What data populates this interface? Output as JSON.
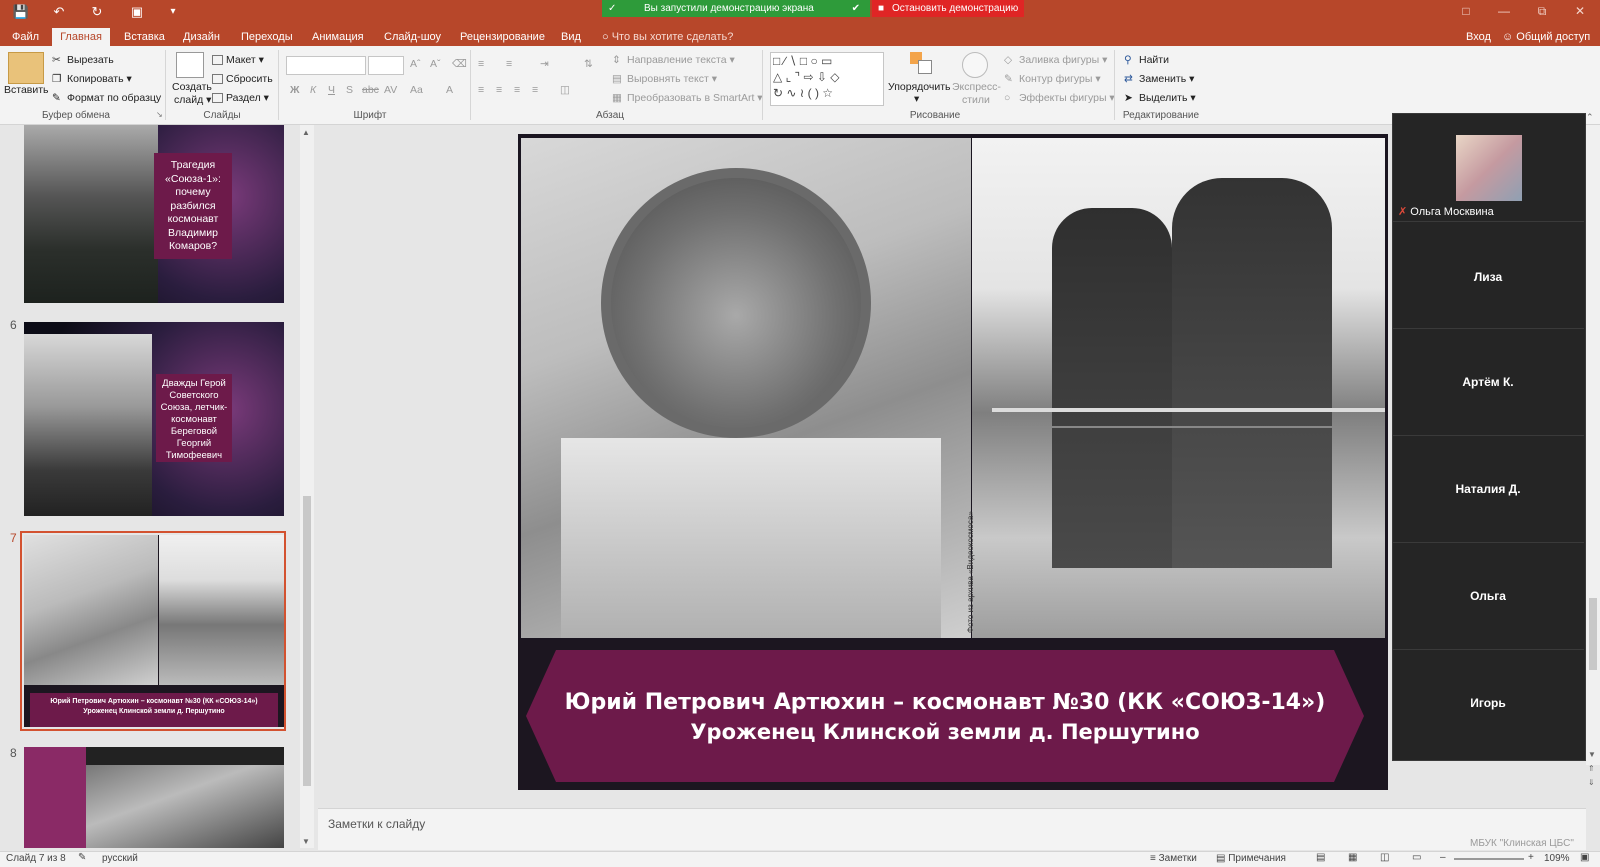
{
  "window": {
    "share_banner": "Вы запустили демонстрацию экрана",
    "stop_share": "Остановить демонстрацию"
  },
  "tabs": [
    "Файл",
    "Главная",
    "Вставка",
    "Дизайн",
    "Переходы",
    "Анимация",
    "Слайд-шоу",
    "Рецензирование",
    "Вид"
  ],
  "tell_me": "Что вы хотите сделать?",
  "account": {
    "signin": "Вход",
    "share": "Общий доступ"
  },
  "ribbon": {
    "paste": "Вставить",
    "cut": "Вырезать",
    "copy": "Копировать",
    "format_painter": "Формат по образцу",
    "clipboard_group": "Буфер обмена",
    "new_slide_1": "Создать",
    "new_slide_2": "слайд",
    "layout": "Макет",
    "reset": "Сбросить",
    "section": "Раздел",
    "slides_group": "Слайды",
    "font_group": "Шрифт",
    "text_direction": "Направление текста",
    "align_text": "Выровнять текст",
    "smartart": "Преобразовать в SmartArt",
    "paragraph_group": "Абзац",
    "arrange": "Упорядочить",
    "quick_styles_1": "Экспресс-",
    "quick_styles_2": "стили",
    "shape_fill": "Заливка фигуры",
    "shape_outline": "Контур фигуры",
    "shape_effects": "Эффекты фигуры",
    "drawing_group": "Рисование",
    "find": "Найти",
    "replace": "Заменить",
    "select": "Выделить",
    "editing_group": "Редактирование"
  },
  "thumbnails": [
    {
      "number": "",
      "text": "Трагедия «Союза-1»: почему разбился космонавт Владимир Комаров?"
    },
    {
      "number": "6",
      "text": "Дважды Герой Советского Союза, летчик-космонавт Береговой Георгий Тимофеевич"
    },
    {
      "number": "7",
      "text_line1": "Юрий Петрович Артюхин – космонавт №30 (КК «СОЮЗ-14»)",
      "text_line2": "Уроженец Клинской земли д. Першутино"
    },
    {
      "number": "8"
    }
  ],
  "slide": {
    "caption_line1": "Юрий Петрович Артюхин – космонавт №30 (КК «СОЮЗ-14»)",
    "caption_line2": "Уроженец Клинской земли д. Першутино",
    "photo_credit": "Фото из архива «Видеокосмоса»"
  },
  "participants": [
    {
      "name": "Ольга Москвина"
    },
    {
      "name": "Лиза"
    },
    {
      "name": "Артём К."
    },
    {
      "name": "Наталия Д."
    },
    {
      "name": "Ольга"
    },
    {
      "name": "Игорь"
    }
  ],
  "notes_placeholder": "Заметки к слайду",
  "status": {
    "slide_info": "Слайд 7 из 8",
    "language": "русский",
    "notes": "Заметки",
    "comments": "Примечания",
    "zoom": "109%",
    "watermark": "МБУК \"Клинская ЦБС\""
  },
  "colors": {
    "ribbon_accent": "#b7472a",
    "slide_banner": "#6d1a4a",
    "share_green": "#2e9b3a",
    "stop_red": "#e02525"
  }
}
